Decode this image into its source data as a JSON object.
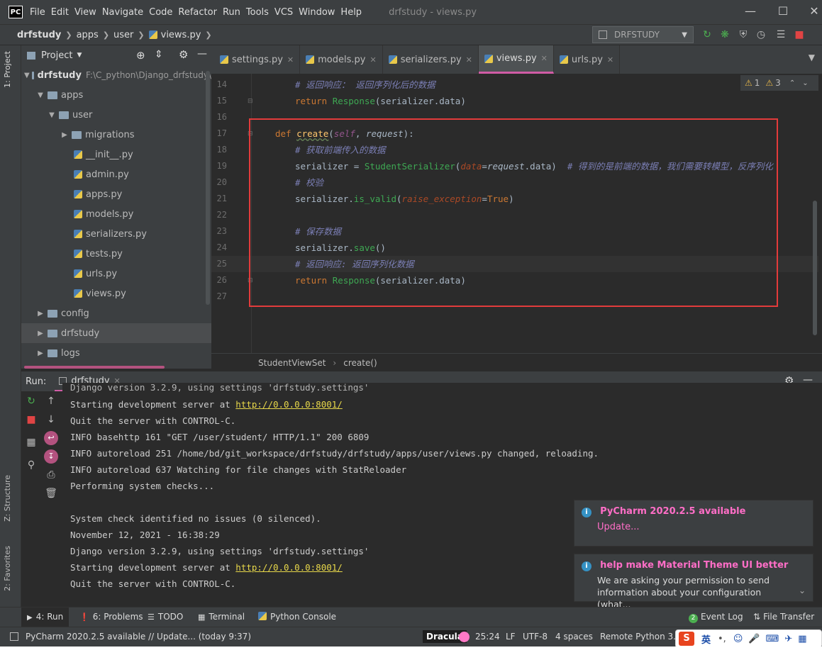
{
  "app": {
    "logo": "PC",
    "window_title": "drfstudy - views.py",
    "menu": [
      "File",
      "Edit",
      "View",
      "Navigate",
      "Code",
      "Refactor",
      "Run",
      "Tools",
      "VCS",
      "Window",
      "Help"
    ]
  },
  "navbar": {
    "crumbs": [
      "drfstudy",
      "apps",
      "user",
      "views.py"
    ],
    "run_config": "DRFSTUDY"
  },
  "project": {
    "header": "Project",
    "root_name": "drfstudy",
    "root_path": "F:\\C_python\\Django_drfstudy\\",
    "tree": {
      "apps": "apps",
      "user": "user",
      "migrations": "migrations",
      "files": [
        "__init__.py",
        "admin.py",
        "apps.py",
        "models.py",
        "serializers.py",
        "tests.py",
        "urls.py",
        "views.py"
      ],
      "config": "config",
      "drfstudy": "drfstudy",
      "logs": "logs"
    }
  },
  "left_strip": {
    "project_tab": "1: Project",
    "structure_tab": "Z: Structure",
    "favorites_tab": "2: Favorites"
  },
  "editor": {
    "tabs": [
      "settings.py",
      "models.py",
      "serializers.py",
      "views.py",
      "urls.py"
    ],
    "active_tab": "views.py",
    "inspection": {
      "warnings": "1",
      "weak_warnings": "3"
    },
    "lines": [
      {
        "n": "14",
        "text": "# 返回响应： 返回序列化后的数据"
      },
      {
        "n": "15",
        "text": "return Response(serializer.data)"
      },
      {
        "n": "16",
        "text": ""
      },
      {
        "n": "17",
        "text": "def create(self, request):"
      },
      {
        "n": "18",
        "text": "# 获取前端传入的数据"
      },
      {
        "n": "19",
        "text": "serializer = StudentSerializer(data=request.data)  # 得到的是前端的数据，我们需要转模型，反序列化"
      },
      {
        "n": "20",
        "text": "# 校验"
      },
      {
        "n": "21",
        "text": "serializer.is_valid(raise_exception=True)"
      },
      {
        "n": "22",
        "text": ""
      },
      {
        "n": "23",
        "text": "# 保存数据"
      },
      {
        "n": "24",
        "text": "serializer.save()"
      },
      {
        "n": "25",
        "text": "# 返回响应: 返回序列化数据"
      },
      {
        "n": "26",
        "text": "return Response(serializer.data)"
      },
      {
        "n": "27",
        "text": ""
      }
    ],
    "breadcrumb": [
      "StudentViewSet",
      "create()"
    ]
  },
  "run": {
    "label": "Run:",
    "tab": "drfstudy",
    "console": [
      "Django version 3.2.9, using settings 'drfstudy.settings'",
      "Starting development server at ",
      "Quit the server with CONTROL-C.",
      "INFO basehttp 161 \"GET /user/student/ HTTP/1.1\" 200 6809",
      "INFO autoreload 251 /home/bd/git_workspace/drfstudy/drfstudy/apps/user/views.py changed, reloading.",
      "INFO autoreload 637 Watching for file changes with StatReloader",
      "Performing system checks...",
      "",
      "System check identified no issues (0 silenced).",
      "November 12, 2021 - 16:38:29",
      "Django version 3.2.9, using settings 'drfstudy.settings'",
      "Starting development server at ",
      "Quit the server with CONTROL-C."
    ],
    "server_url": "http://0.0.0.0:8001/"
  },
  "notifications": [
    {
      "title": "PyCharm 2020.2.5 available",
      "body": "Update..."
    },
    {
      "title": "help make Material Theme UI better",
      "body": "We are asking your permission to send information about your configuration (what..."
    }
  ],
  "bottom_tools": {
    "run": "4: Run",
    "problems": "6: Problems",
    "todo": "TODO",
    "terminal": "Terminal",
    "python_console": "Python Console",
    "event_log": "Event Log",
    "event_count": "2",
    "file_transfer": "File Transfer"
  },
  "status": {
    "message": "PyCharm 2020.2.5 available // Update... (today 9:37)",
    "theme": "Dracula",
    "position": "25:24",
    "line_sep": "LF",
    "encoding": "UTF-8",
    "indent": "4 spaces",
    "interpreter": "Remote Python 3.6"
  },
  "ime": {
    "lang": "英"
  },
  "colors": {
    "accent": "#d05ca5",
    "highlight_box": "#e33b3b",
    "link": "#e8d84a",
    "notif_title": "#ff6ec7"
  }
}
